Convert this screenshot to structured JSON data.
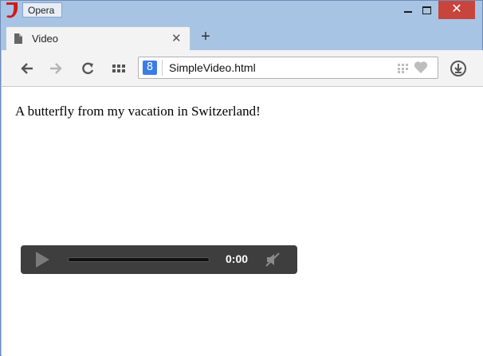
{
  "window": {
    "app_label": "Opera",
    "controls": {
      "minimize": "minimize",
      "maximize": "maximize",
      "close": "✕"
    }
  },
  "tabs": [
    {
      "title": "Video",
      "close_label": "✕"
    }
  ],
  "new_tab_label": "+",
  "toolbar": {
    "back_icon": "back-arrow-icon",
    "forward_icon": "forward-arrow-icon",
    "reload_icon": "reload-icon",
    "speed_dial_icon": "speed-dial-icon",
    "address": {
      "search_engine_glyph": "8",
      "url": "SimpleVideo.html"
    },
    "download_icon": "download-icon"
  },
  "page": {
    "caption": "A butterfly from my vacation in Switzerland!",
    "media_player": {
      "time": "0:00",
      "progress": 0,
      "muted": true
    }
  },
  "colors": {
    "frame": "#a8c4e4",
    "close_button": "#c7453c",
    "player_bg": "#3e3e3e",
    "google_blue": "#3b7be8"
  }
}
